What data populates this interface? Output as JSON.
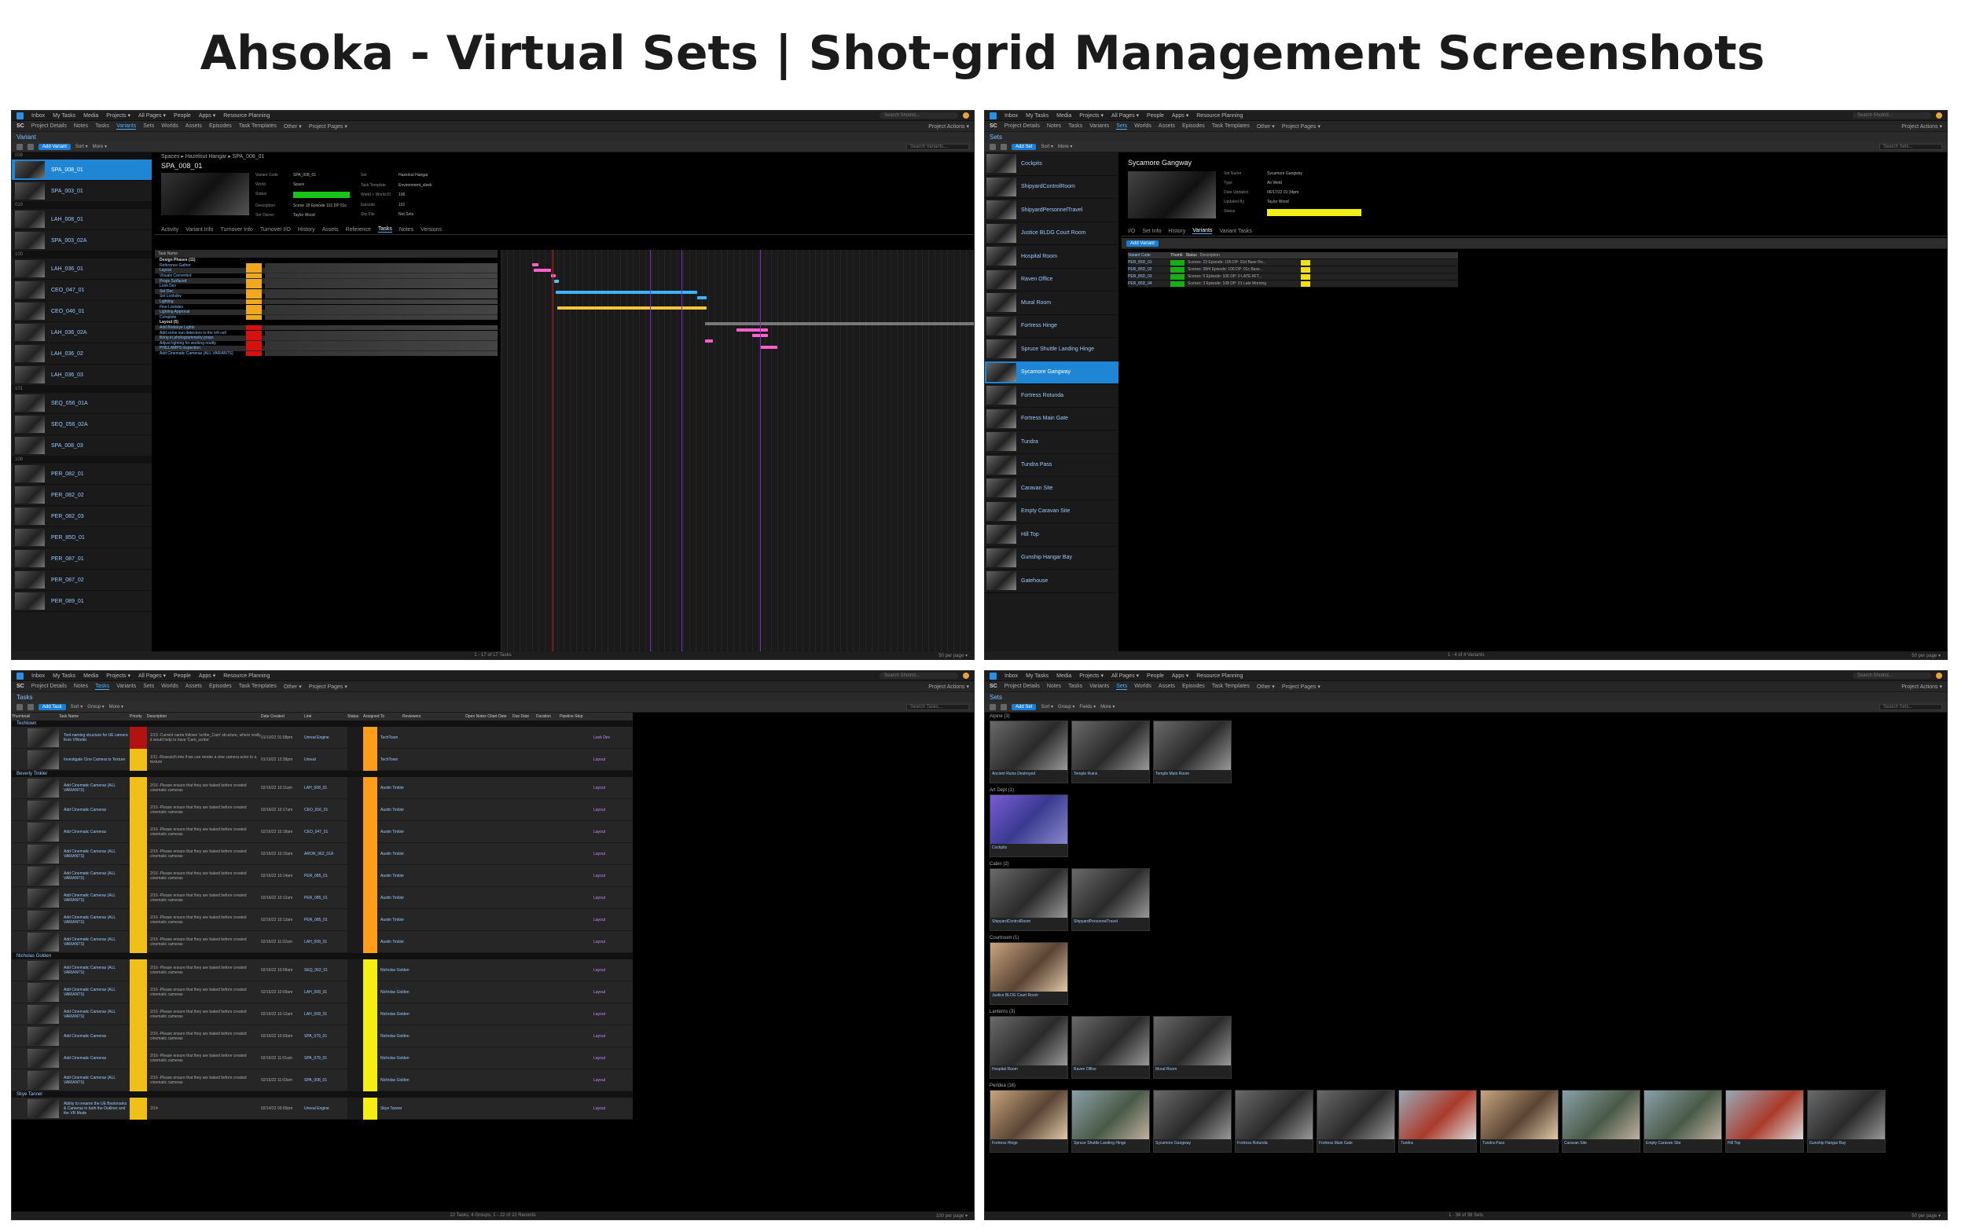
{
  "title": "Ahsoka - Virtual Sets | Shot-grid Management Screenshots",
  "nav": {
    "items": [
      "Inbox",
      "My Tasks",
      "Media",
      "Projects ▾",
      "All Pages ▾",
      "People",
      "Apps ▾",
      "Resource Planning"
    ],
    "search_placeholder": "Search Shotrid...",
    "project_code": "SC",
    "project_items": [
      "Project Details",
      "Notes",
      "Tasks",
      "Variants",
      "Sets",
      "Worlds",
      "Assets",
      "Episodes",
      "Task Templates",
      "Other ▾",
      "Project Pages ▾"
    ],
    "project_actions": "Project Actions ▾"
  },
  "panel1": {
    "page_title": "Variant",
    "toolbar": {
      "add": "Add Variant",
      "sort": "Sort ▾",
      "more": "More ▾",
      "search": "Search Variants..."
    },
    "list_groups": [
      "008",
      "019",
      "100",
      "101",
      "108"
    ],
    "list_items": [
      "SPA_008_01",
      "SPA_003_01",
      "LAH_008_01",
      "SPA_003_02A",
      "LAH_036_01",
      "CEO_047_01",
      "CEO_046_01",
      "LAH_036_02A",
      "LAH_036_02",
      "LAH_036_03",
      "SEQ_056_01A",
      "SEQ_056_02A",
      "SPA_008_03",
      "PER_082_01",
      "PER_082_02",
      "PER_082_03",
      "PER_85D_01",
      "PER_087_01",
      "PER_087_02",
      "PER_089_01"
    ],
    "breadcrumb": "Spaces ▸ Hazelnut Hangar ▸ SPA_008_01",
    "entity_title": "SPA_008_01",
    "fields": [
      {
        "k": "Variant Code",
        "v": "SPA_008_01"
      },
      {
        "k": "World",
        "v": "Space"
      },
      {
        "k": "Status",
        "v": ""
      },
      {
        "k": "Description",
        "v": "Scene 18 Episode 101 DP 01c"
      },
      {
        "k": "Set Owner",
        "v": "Taylor Wood"
      }
    ],
    "fields2": [
      {
        "k": "Set",
        "v": "Hazelnut Hangar"
      },
      {
        "k": "Task Template",
        "v": "Environment_sleek"
      },
      {
        "k": "World + World ID",
        "v": "106"
      },
      {
        "k": "Episode",
        "v": "101"
      },
      {
        "k": "Sky File",
        "v": "Not Sets"
      }
    ],
    "tabs": [
      "Activity",
      "Variant Info",
      "Turnover Info",
      "Turnover I/O",
      "History",
      "Assets",
      "Reference",
      "Tasks",
      "Notes",
      "Versions"
    ],
    "active_tab": "Tasks",
    "task_header": "Task Name",
    "task_groups": [
      "Design Phases (11)",
      "Layout (5)"
    ],
    "tasks": [
      "Reference Gather",
      "Layout",
      "Visuals Converted",
      "Props Surfaced",
      "Look Dev",
      "Set Dec",
      "Set Lookdev",
      "Lighting",
      "Fine Lookdev",
      "Lighting Approval",
      "Complete",
      "Add Birdseye Lights",
      "Add some sun detectors to the left cell",
      "Bring in photogrammetry props",
      "Adjust lighting for working reality",
      "PHILLAMPS inspection",
      "Add Cinematic Cameras (ALL VARIANTS)"
    ],
    "footer": "1 - 17 of 17 Tasks",
    "footer_right": "50 per page ▾"
  },
  "panel2": {
    "page_title": "Sets",
    "toolbar": {
      "add": "Add Set",
      "sort": "Sort ▾",
      "more": "More ▾",
      "search": "Search Sets..."
    },
    "list_items": [
      "Cockpits",
      "ShipyardControlRoom",
      "ShipyardPersonnelTravel",
      "Justice BLDG Court Room",
      "Hospital Room",
      "Raven Office",
      "Mural Room",
      "Fortress Hinge",
      "Spruce Shuttle Landing Hinge",
      "Sycamore Gangway",
      "Fortress Rotunda",
      "Fortress Main Gate",
      "Tundra",
      "Tundra Pass",
      "Caravan Site",
      "Empty Caravan Site",
      "Hill Top",
      "Gunship Hangar Bay",
      "Gatehouse"
    ],
    "selected": "Sycamore Gangway",
    "entity_title": "Sycamore Gangway",
    "fields": [
      {
        "k": "Set Name",
        "v": "Sycamore Gangway"
      },
      {
        "k": "Type",
        "v": "Air Weld"
      },
      {
        "k": "Date Updated",
        "v": "06/17/22 01:34pm"
      },
      {
        "k": "Updated By",
        "v": "Taylor Wood"
      },
      {
        "k": "Status",
        "v": ""
      }
    ],
    "tabs": [
      "I/O",
      "Set Info",
      "History",
      "Variants",
      "Variant Tasks"
    ],
    "active_tab": "Variants",
    "rows": [
      {
        "code": "PER_85D_01",
        "desc": "Scenes: 23 Episode: 106 DP: 01d Base Ro..."
      },
      {
        "code": "PER_85D_02",
        "desc": "Scenes: 38/4 Episode: 106 DP: 01c Base..."
      },
      {
        "code": "PER_85D_03",
        "desc": "Scenes: 5 Episode: 106 DP: 0 LATE AFT..."
      },
      {
        "code": "PER_85D_04",
        "desc": "Scenes: 3 Episode: 108 DP: 01 Late Morning"
      }
    ],
    "table_header": [
      "Variant Code",
      "Thumb",
      "Status",
      "Description"
    ],
    "footer": "1 - 4 of 4 Variants",
    "footer_right": "50 per page ▾"
  },
  "panel3": {
    "page_title": "Tasks",
    "toolbar": {
      "add": "Add Task",
      "sort": "Sort ▾",
      "group": "Group ▾",
      "more": "More ▾",
      "search": "Search Tasks..."
    },
    "columns": [
      "Thumbnail",
      "Task Name",
      "Priority",
      "Description",
      "Date Created",
      "Link",
      "Status",
      "Assigned To",
      "Reviewers",
      "Open Notes Count",
      "Start Date",
      "Due Date",
      "Duration",
      "Pipeline Step"
    ],
    "groups": [
      "Techtown",
      "Beverly Tinkler",
      "Nicholas Golden",
      "Skye Tanner"
    ],
    "rows": [
      {
        "name": "Tool-naming structure for UE camera from VWorkb",
        "desc": "1/19 -Current name follows 'scribe_Cam' structure, where really it would help to have 'Cam_scribe'",
        "date": "01/10/22 01:08pm",
        "link": "Unreal Engine",
        "assign": "TechTown",
        "step": "Look Dev",
        "p": "red",
        "s": "orange"
      },
      {
        "name": "Investigate Cine Camera to Texture",
        "desc": "1/11 -Research into if we can render a cine camera actor to a texture",
        "date": "01/10/22 12:38pm",
        "link": "Unreal",
        "assign": "TechTown",
        "step": "Layout",
        "p": "yellow",
        "s": "orange"
      },
      {
        "name": "Add Cinematic Cameras (ALL VARIANTS)",
        "desc": "2/16 -Please ensure that they are baked before created cinematic cameras",
        "date": "02/16/22 10:11am",
        "link": "LAH_008_01",
        "assign": "Austin Tinkler",
        "step": "Layout",
        "p": "yellow",
        "s": "orange"
      },
      {
        "name": "Add Cinematic Cameras",
        "desc": "2/16 -Please ensure that they are baked before created cinematic cameras",
        "date": "02/16/22 10:17am",
        "link": "CEO_016_01",
        "assign": "Austin Tinkler",
        "step": "Layout",
        "p": "yellow",
        "s": "orange"
      },
      {
        "name": "Add Cinematic Cameras",
        "desc": "2/16 -Please ensure that they are baked before created cinematic cameras",
        "date": "02/16/22 10:18am",
        "link": "CEO_047_01",
        "assign": "Austin Tinkler",
        "step": "Layout",
        "p": "yellow",
        "s": "orange"
      },
      {
        "name": "Add Cinematic Cameras (ALL VARIANTS)",
        "desc": "2/16 -Please ensure that they are baked before created cinematic cameras",
        "date": "02/16/22 10:15am",
        "link": "ARON_062_01A",
        "assign": "Austin Tinkler",
        "step": "Layout",
        "p": "yellow",
        "s": "orange"
      },
      {
        "name": "Add Cinematic Cameras (ALL VARIANTS)",
        "desc": "2/16 -Please ensure that they are baked before created cinematic cameras",
        "date": "02/16/22 10:14am",
        "link": "PER_085_01",
        "assign": "Austin Tinkler",
        "step": "Layout",
        "p": "yellow",
        "s": "orange"
      },
      {
        "name": "Add Cinematic Cameras (ALL VARIANTS)",
        "desc": "2/16 -Please ensure that they are baked before created cinematic cameras",
        "date": "02/16/22 10:12am",
        "link": "PER_085_01",
        "assign": "Austin Tinkler",
        "step": "Layout",
        "p": "yellow",
        "s": "orange"
      },
      {
        "name": "Add Cinematic Cameras (ALL VARIANTS)",
        "desc": "2/16 -Please ensure that they are baked before created cinematic cameras",
        "date": "02/16/22 10:13am",
        "link": "PER_085_01",
        "assign": "Austin Tinkler",
        "step": "Layout",
        "p": "yellow",
        "s": "orange"
      },
      {
        "name": "Add Cinematic Cameras (ALL VARIANTS)",
        "desc": "2/16 -Please ensure that they are baked before created cinematic cameras",
        "date": "02/16/22 11:02am",
        "link": "LAH_008_01",
        "assign": "Austin Tinkler",
        "step": "Layout",
        "p": "yellow",
        "s": "orange"
      },
      {
        "name": "Add Cinematic Cameras (ALL VARIANTS)",
        "desc": "2/16 -Please ensure that they are baked before created cinematic cameras",
        "date": "02/16/22 10:08am",
        "link": "SEQ_062_01",
        "assign": "Nicholas Golden",
        "step": "Layout",
        "p": "yellow",
        "s": "yellow"
      },
      {
        "name": "Add Cinematic Cameras (ALL VARIANTS)",
        "desc": "2/16 -Please ensure that they are baked before created cinematic cameras",
        "date": "02/16/22 10:09am",
        "link": "LAH_008_01",
        "assign": "Nicholas Golden",
        "step": "Layout",
        "p": "yellow",
        "s": "yellow"
      },
      {
        "name": "Add Cinematic Cameras (ALL VARIANTS)",
        "desc": "2/16 -Please ensure that they are baked before created cinematic cameras",
        "date": "02/16/22 10:12am",
        "link": "LAH_008_01",
        "assign": "Nicholas Golden",
        "step": "Layout",
        "p": "yellow",
        "s": "yellow"
      },
      {
        "name": "Add Cinematic Cameras",
        "desc": "2/16 -Please ensure that they are baked before created cinematic cameras",
        "date": "02/16/22 10:03am",
        "link": "SPA_079_01",
        "assign": "Nicholas Golden",
        "step": "Layout",
        "p": "yellow",
        "s": "yellow"
      },
      {
        "name": "Add Cinematic Cameras",
        "desc": "2/16 -Please ensure that they are baked before created cinematic cameras",
        "date": "02/16/22 11:01am",
        "link": "SPA_079_01",
        "assign": "Nicholas Golden",
        "step": "Layout",
        "p": "yellow",
        "s": "yellow"
      },
      {
        "name": "Add Cinematic Cameras (ALL VARIANTS)",
        "desc": "2/16 -Please ensure that they are baked before created cinematic cameras",
        "date": "02/16/22 11:03am",
        "link": "SPA_008_01",
        "assign": "Nicholas Golden",
        "step": "Layout",
        "p": "yellow",
        "s": "yellow"
      },
      {
        "name": "Ability to rename the UE Bookmarks & Cameras in both the Outliner and the VR Mode",
        "desc": "2/14",
        "date": "02/14/22 03:00pm",
        "link": "Unreal Engine",
        "assign": "Skye Tanner",
        "step": "Layout",
        "p": "yellow",
        "s": "yellow"
      }
    ],
    "footer": "22 Tasks, 4 Groups, 1 - 22 of 22 Records",
    "footer_right": "100 per page ▾"
  },
  "panel4": {
    "page_title": "Sets",
    "toolbar": {
      "add": "Add Set",
      "sort": "Sort ▾",
      "group": "Group ▾",
      "fields": "Fields ▾",
      "more": "More ▾",
      "search": "Search Sets..."
    },
    "groups": [
      {
        "name": "Alpine (3)",
        "cards": [
          {
            "n": "Ancient Ruins Destroyed",
            "c": ""
          },
          {
            "n": "Temple Ruins",
            "c": ""
          },
          {
            "n": "Temple Main Room",
            "c": ""
          }
        ]
      },
      {
        "name": "Art Dept (1)",
        "cards": [
          {
            "n": "Cockpits",
            "c": "purple"
          }
        ]
      },
      {
        "name": "Cabin (2)",
        "cards": [
          {
            "n": "ShipyardControlRoom",
            "c": ""
          },
          {
            "n": "ShipyardPersonnelTravel",
            "c": ""
          }
        ]
      },
      {
        "name": "Courtroom (1)",
        "cards": [
          {
            "n": "Justice BLDG Court Room",
            "c": "warm"
          }
        ]
      },
      {
        "name": "Lanterns (3)",
        "cards": [
          {
            "n": "Hospital Room",
            "c": ""
          },
          {
            "n": "Raven Office",
            "c": ""
          },
          {
            "n": "Mural Room",
            "c": ""
          }
        ]
      },
      {
        "name": "Peridea (16)",
        "cards": [
          {
            "n": "Fortress Hinge",
            "c": "warm"
          },
          {
            "n": "Spruce Shuttle Landing Hinge",
            "c": "green"
          },
          {
            "n": "Sycamore Gangway",
            "c": ""
          },
          {
            "n": "Fortress Rotunda",
            "c": ""
          },
          {
            "n": "Fortress Main Gate",
            "c": ""
          },
          {
            "n": "Tundra",
            "c": "red"
          },
          {
            "n": "Tundra Pass",
            "c": "warm"
          },
          {
            "n": "Caravan Site",
            "c": "green"
          },
          {
            "n": "Empty Caravan Site",
            "c": "green"
          },
          {
            "n": "Hill Top",
            "c": "red"
          },
          {
            "n": "Gunship Hangar Bay",
            "c": ""
          }
        ]
      }
    ],
    "footer": "1 - 38 of 38 Sets",
    "footer_right": "50 per page ▾"
  },
  "colors": {
    "accent": "#1f86d6",
    "status_green": "#19c419",
    "status_yellow": "#f0f018",
    "priority_orange": "#f0a820",
    "status_orange": "#ff9d1a",
    "critical_red": "#d71010"
  }
}
